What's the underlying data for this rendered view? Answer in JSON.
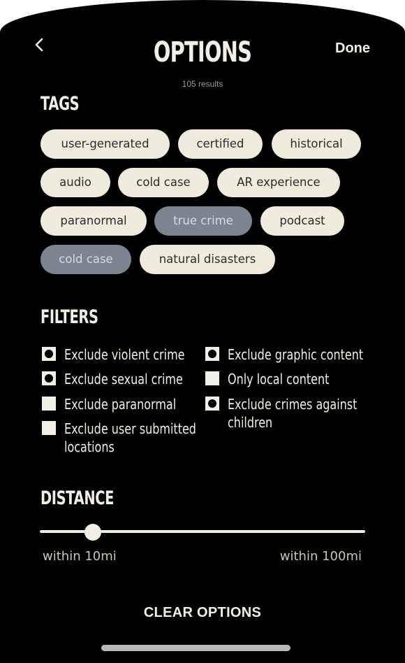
{
  "header": {
    "title": "OPTIONS",
    "done_label": "Done",
    "results_text": "105 results"
  },
  "tags": {
    "section_title": "TAGS",
    "items": [
      {
        "label": "user-generated",
        "selected": false
      },
      {
        "label": "certified",
        "selected": false
      },
      {
        "label": "historical",
        "selected": false
      },
      {
        "label": "audio",
        "selected": false
      },
      {
        "label": "cold case",
        "selected": false
      },
      {
        "label": "AR experience",
        "selected": false
      },
      {
        "label": "paranormal",
        "selected": false
      },
      {
        "label": "true crime",
        "selected": true
      },
      {
        "label": "podcast",
        "selected": false
      },
      {
        "label": "cold case",
        "selected": true
      },
      {
        "label": "natural disasters",
        "selected": false
      }
    ]
  },
  "filters": {
    "section_title": "FILTERS",
    "items": [
      {
        "label": "Exclude violent crime",
        "checked": true
      },
      {
        "label": "Exclude sexual crime",
        "checked": true
      },
      {
        "label": "Exclude paranormal",
        "checked": false
      },
      {
        "label": "Exclude user submitted\nlocations",
        "checked": false
      },
      {
        "label": "Exclude graphic content",
        "checked": true
      },
      {
        "label": "Only local content",
        "checked": false
      },
      {
        "label": "Exclude crimes against\nchildren",
        "checked": true
      }
    ]
  },
  "distance": {
    "section_title": "DISTANCE",
    "min_label": "within 10mi",
    "max_label": "within 100mi",
    "value_fraction": 0.17
  },
  "clear_label": "CLEAR OPTIONS",
  "colors": {
    "background": "#000000",
    "chip": "#efecdd",
    "chip_selected": "#7d8490",
    "text": "#f2f0e6"
  }
}
